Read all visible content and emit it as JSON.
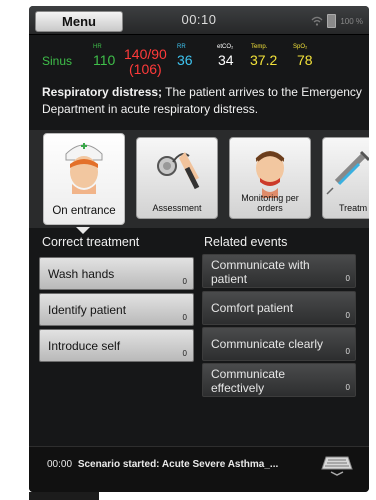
{
  "statusbar": {
    "menu_label": "Menu",
    "clock": "00:10",
    "battery_pct": "100 %"
  },
  "vitals": {
    "rhythm": "Sinus",
    "hr": {
      "label": "HR",
      "value": "110"
    },
    "bp": {
      "value": "140/90",
      "mean": "(106)"
    },
    "rr": {
      "label": "RR",
      "value": "36"
    },
    "etco2": {
      "label": "etCO₂",
      "value": "34"
    },
    "temp": {
      "label": "Temp.",
      "value": "37.2"
    },
    "spo2": {
      "label": "SpO₂",
      "value": "78"
    }
  },
  "colors": {
    "rhythm": "#3fbf4a",
    "hr": "#3fbf4a",
    "bp": "#ff3a3a",
    "rr": "#3ec4f0",
    "etco2": "#ffffff",
    "temp": "#f2e23a",
    "spo2": "#f2e23a"
  },
  "scenario": {
    "heading": "Respiratory distress;",
    "text": "The patient arrives to the Emergency Department in acute respiratory distress."
  },
  "categories": [
    {
      "label": "On entrance",
      "icon": "nurse-icon",
      "active": true
    },
    {
      "label": "Assessment",
      "icon": "stethoscope-icon",
      "active": false
    },
    {
      "label": "Monitoring per orders",
      "icon": "patient-monitoring-icon",
      "active": false
    },
    {
      "label": "Treatm",
      "icon": "syringe-icon",
      "active": false
    }
  ],
  "treatment": {
    "title": "Correct treatment",
    "items": [
      {
        "label": "Wash hands",
        "count": "0"
      },
      {
        "label": "Identify patient",
        "count": "0"
      },
      {
        "label": "Introduce self",
        "count": "0"
      }
    ]
  },
  "events": {
    "title": "Related events",
    "items": [
      {
        "label": "Communicate with patient",
        "count": "0"
      },
      {
        "label": "Comfort patient",
        "count": "0"
      },
      {
        "label": "Communicate clearly",
        "count": "0"
      },
      {
        "label": "Communicate effectively",
        "count": "0"
      }
    ]
  },
  "footer": {
    "time": "00:00",
    "message": "Scenario started: Acute Severe Asthma_..."
  }
}
